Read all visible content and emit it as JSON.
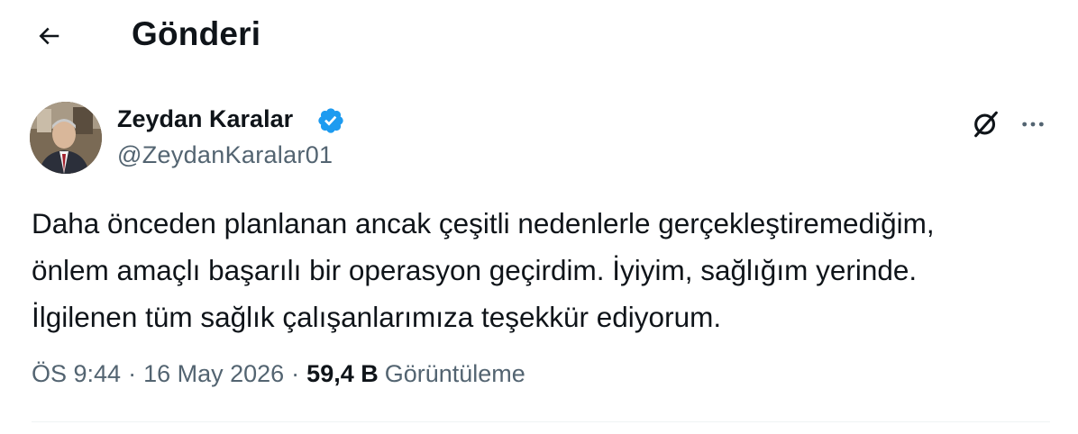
{
  "header": {
    "back_icon": "arrow-left-icon",
    "title": "Gönderi"
  },
  "post": {
    "author": {
      "name": "Zeydan Karalar",
      "handle": "@ZeydanKaralar01",
      "verified": true,
      "verified_color": "#1d9bf0"
    },
    "actions": {
      "grok_icon": "grok-icon",
      "more_icon": "more-horizontal-icon"
    },
    "text": "Daha önceden planlanan ancak çeşitli nedenlerle gerçekleştiremediğim,\nönlem amaçlı başarılı bir operasyon geçirdim. İyiyim, sağlığım yerinde.\nİlgilenen tüm sağlık çalışanlarımıza teşekkür ediyorum.",
    "meta": {
      "time": "ÖS 9:44",
      "separator": "·",
      "date": "16 May 2026",
      "views_count": "59,4 B",
      "views_label": "Görüntüleme"
    }
  },
  "colors": {
    "text_primary": "#0f1419",
    "text_secondary": "#536471",
    "divider": "#eff3f4",
    "accent": "#1d9bf0"
  }
}
